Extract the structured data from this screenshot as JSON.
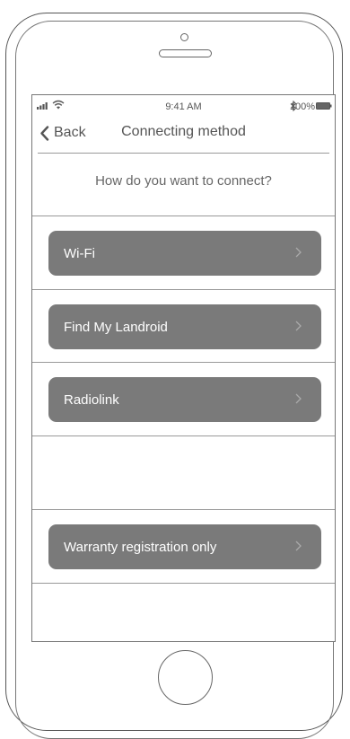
{
  "status_bar": {
    "time": "9:41 AM",
    "battery": "100%",
    "icons": [
      "signal-icon",
      "wifi-icon",
      "bluetooth-icon",
      "battery-icon"
    ]
  },
  "nav": {
    "back_label": "Back",
    "title": "Connecting method"
  },
  "question": "How do you want to connect?",
  "options": [
    {
      "label": "Wi-Fi"
    },
    {
      "label": "Find My Landroid"
    },
    {
      "label": "Radiolink"
    }
  ],
  "warranty_option": {
    "label": "Warranty registration only"
  },
  "colors": {
    "button_bg": "#7a7a7a",
    "button_text": "#ffffff",
    "text": "#555555",
    "divider": "#999999"
  }
}
